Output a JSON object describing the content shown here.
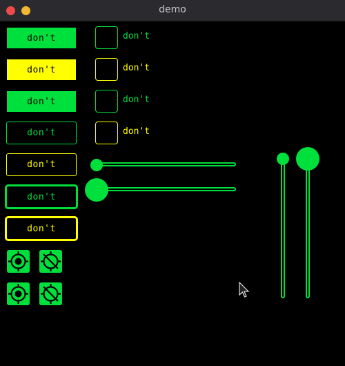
{
  "window": {
    "title": "demo"
  },
  "colors": {
    "accent": "#00e03c",
    "warn": "#ffff00",
    "background": "#000000"
  },
  "buttons": [
    {
      "label": "don't",
      "style": "filled-green"
    },
    {
      "label": "don't",
      "style": "filled-yellow"
    },
    {
      "label": "don't",
      "style": "filled-green"
    },
    {
      "label": "don't",
      "style": "outline-green"
    },
    {
      "label": "don't",
      "style": "outline-yellow"
    },
    {
      "label": "don't",
      "style": "thick-outline-green"
    },
    {
      "label": "don't",
      "style": "thick-outline-yellow"
    }
  ],
  "checkboxes": [
    {
      "label": "don't",
      "color": "green",
      "checked": false
    },
    {
      "label": "don't",
      "color": "yellow",
      "checked": false
    },
    {
      "label": "don't",
      "color": "green",
      "checked": false
    },
    {
      "label": "don't",
      "color": "yellow",
      "checked": false
    }
  ],
  "sliders": {
    "horizontal": [
      {
        "value": 0,
        "knob": "small"
      },
      {
        "value": 0,
        "knob": "large"
      }
    ],
    "vertical": [
      {
        "value": 1,
        "knob": "small"
      },
      {
        "value": 1,
        "knob": "large"
      }
    ]
  },
  "icon_buttons": [
    {
      "icon": "target-icon"
    },
    {
      "icon": "no-target-icon"
    },
    {
      "icon": "target-icon"
    },
    {
      "icon": "no-target-icon"
    }
  ]
}
